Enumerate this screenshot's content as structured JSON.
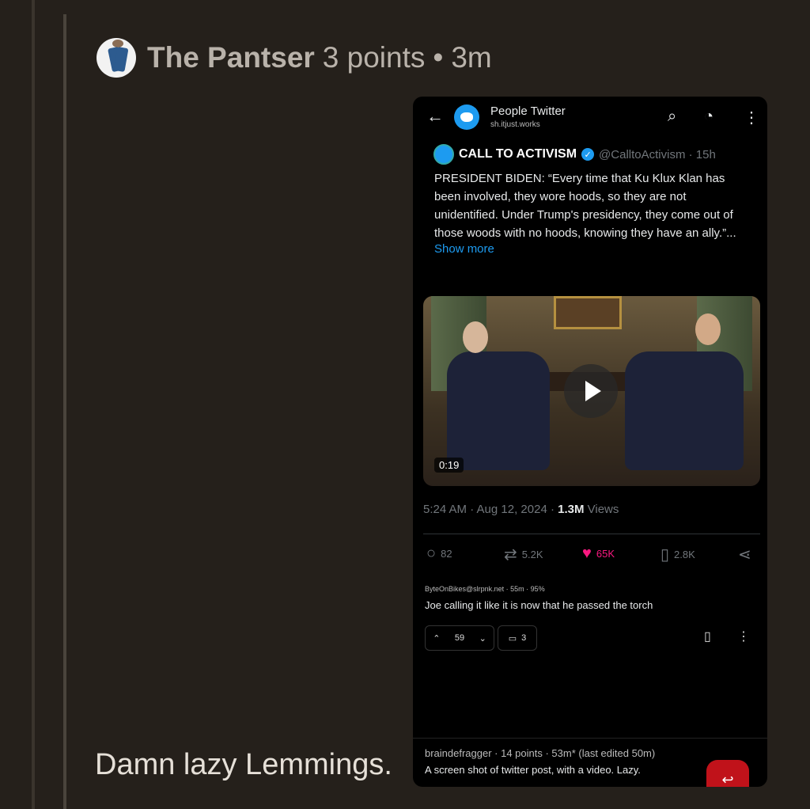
{
  "comment": {
    "author": "The Pantser",
    "points": "3 points",
    "separator": "•",
    "time": "3m",
    "text": "Damn lazy Lemmings."
  },
  "screenshot": {
    "appbar": {
      "community_name": "People Twitter",
      "community_host": "sh.itjust.works",
      "back_icon": "arrow-left-icon",
      "icons": [
        "search-icon",
        "sort-icon",
        "more-vertical-icon"
      ]
    },
    "tweet": {
      "display_name": "CALL TO ACTIVISM",
      "handle_time": "@CalltoActivism · 15h",
      "body": "PRESIDENT BIDEN: “Every time that Ku Klux Klan has been involved, they wore hoods, so they are not unidentified. Under Trump's presidency, they come out of those woods with no hoods, knowing they have an ally.”...",
      "show_more": "Show more",
      "video_duration": "0:19",
      "meta_prefix": "5:24 AM · Aug 12, 2024 · ",
      "views_count": "1.3M",
      "views_label": " Views",
      "actions": {
        "replies": "82",
        "retweets": "5.2K",
        "likes": "65K",
        "bookmarks": "2.8K"
      },
      "accent_color": "#1d9bf0",
      "like_color": "#f91880"
    },
    "lemmy_comment": {
      "meta": "ByteOnBikes@slrpnk.net · 55m · 95%",
      "text": "Joe calling it like it is now that he passed the torch",
      "votes": "59",
      "replies": "3"
    },
    "bottom_comment": {
      "meta": "braindefragger · 14 points · 53m* (last edited 50m)",
      "text": "A screen shot of twitter post, with a video. Lazy."
    }
  }
}
